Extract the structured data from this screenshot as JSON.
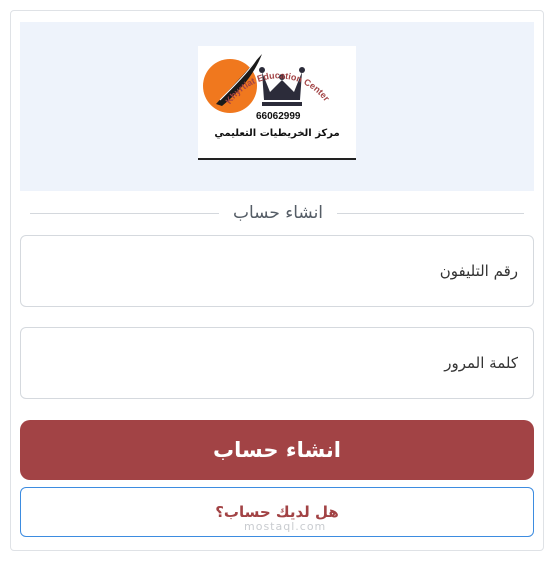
{
  "logo": {
    "phone": "66062999",
    "arc_text": "Khyrtiat Education Center",
    "arabic_name": "مركز الخريطيات التعليمي"
  },
  "divider": {
    "label": "انشاء حساب"
  },
  "form": {
    "phone_placeholder": "رقم التليفون",
    "password_placeholder": "كلمة المرور"
  },
  "buttons": {
    "create_account": "انشاء حساب",
    "have_account": "هل لديك حساب؟"
  },
  "watermark": {
    "text": "mostaql.com"
  },
  "colors": {
    "primary": "#a24345",
    "panel_bg": "#eef3fb",
    "outline": "#3d8ce0",
    "logo_orange": "#f0781e"
  }
}
